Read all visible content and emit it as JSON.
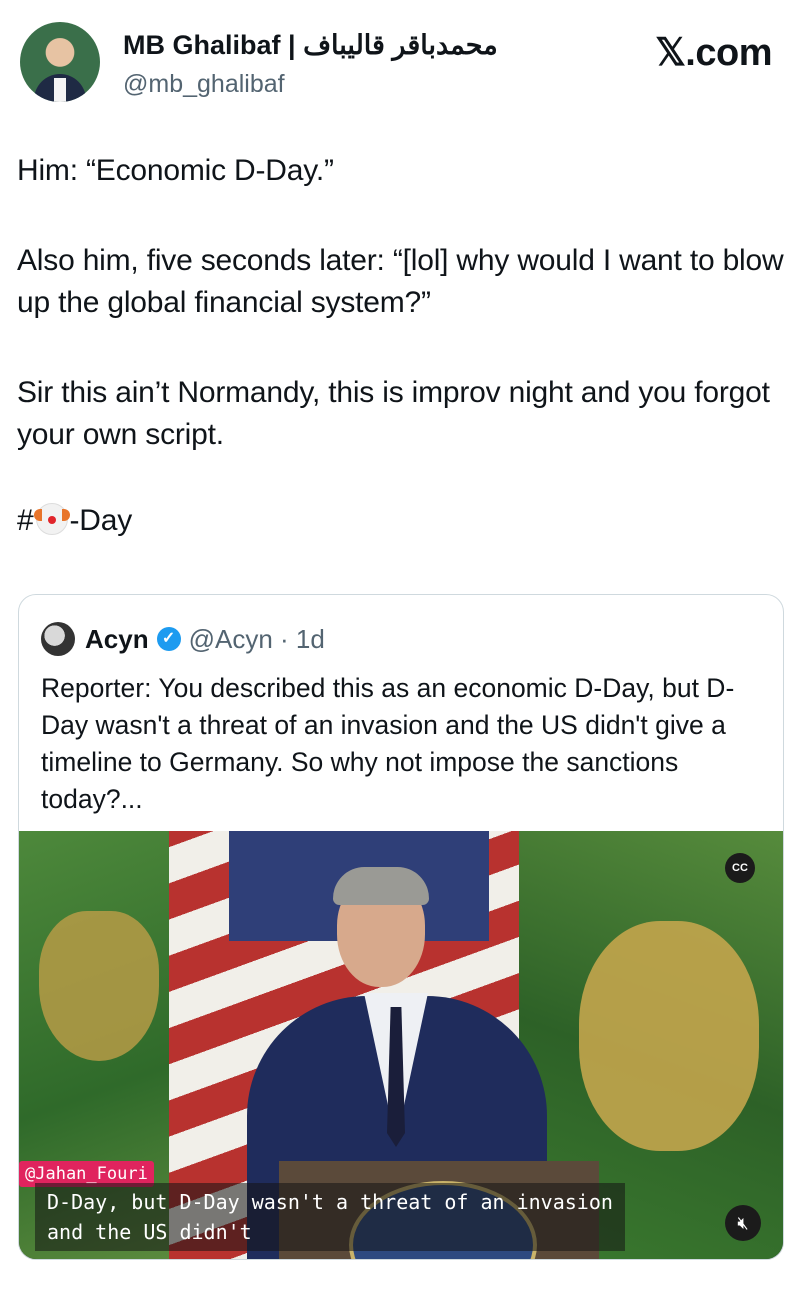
{
  "author": {
    "name": "MB Ghalibaf | محمدباقر قالیباف",
    "handle": "@mb_ghalibaf"
  },
  "brand": "𝕏.com",
  "tweet": {
    "line1": "Him: “Economic D-Day.”",
    "line2": "Also him, five seconds later: “[lol] why would I want to blow up the global financial system?”",
    "line3": "Sir this ain’t Normandy, this is improv night and you forgot your own script.",
    "hashtag_prefix": "#",
    "hashtag_suffix": "-Day"
  },
  "quoted": {
    "name": "Acyn",
    "meta": "@Acyn · 1d",
    "text": "Reporter: You described this as an economic D-Day, but D-Day wasn't a threat of an invasion and the US didn't give a timeline to Germany. So why not impose the sanctions today?...",
    "video": {
      "watermark": "@Jahan_Fouri",
      "caption_line1": "D-Day, but D-Day wasn't a threat of an invasion",
      "caption_line2": "and the US didn't",
      "cc_label": "CC"
    }
  },
  "icons": [
    "verified-badge-icon",
    "cc-icon",
    "mute-icon",
    "clown-emoji-icon"
  ],
  "colors": {
    "verified": "#1d9bf0",
    "muted_text": "#536471",
    "watermark_bg": "#e0245e"
  }
}
